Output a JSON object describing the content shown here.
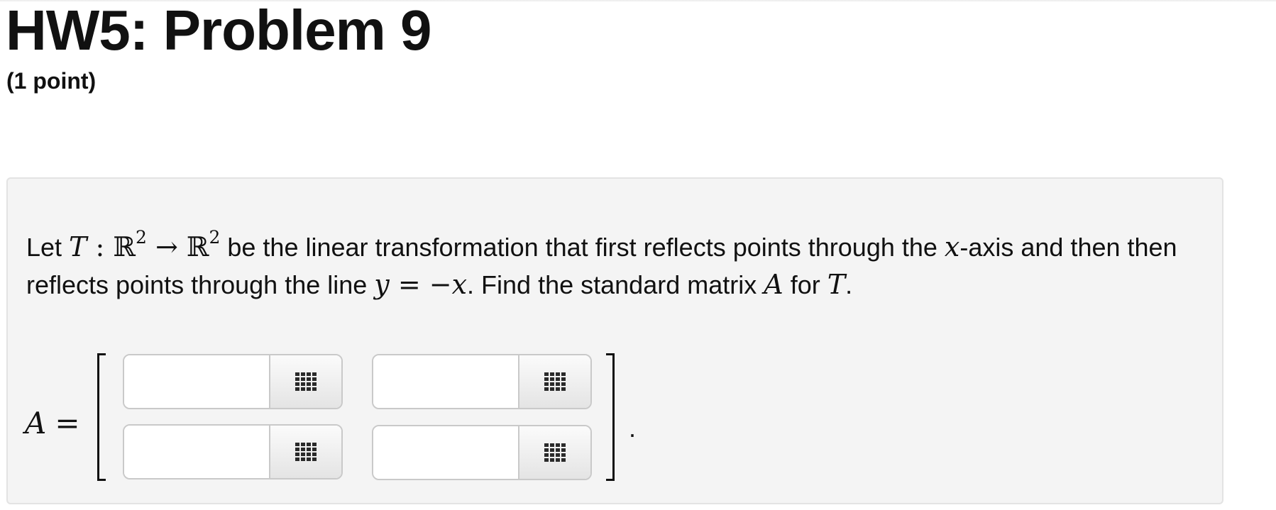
{
  "header": {
    "title": "HW5: Problem 9",
    "points": "(1 point)"
  },
  "problem": {
    "text_let": "Let ",
    "sym_T": "T",
    "sym_colon": " : ",
    "sym_R": "ℝ",
    "sym_exp": "2",
    "sym_arrow": " → ",
    "text_a": " be the linear transformation that first reflects points through the ",
    "sym_x": "x",
    "text_b": "-axis and then then reflects points through the line ",
    "sym_y": "y",
    "sym_eq_negx": " = −",
    "sym_x2": "x",
    "text_c": ". Find the standard matrix ",
    "sym_A": "A",
    "text_d": " for ",
    "sym_T2": "T",
    "text_e": "."
  },
  "answer": {
    "lhs_var": "A",
    "lhs_eq": "=",
    "end_dot": ".",
    "matrix_rows": 2,
    "matrix_cols": 2,
    "cells": [
      {
        "value": "",
        "button_icon": "matrix-grid-icon"
      },
      {
        "value": "",
        "button_icon": "matrix-grid-icon"
      },
      {
        "value": "",
        "button_icon": "matrix-grid-icon"
      },
      {
        "value": "",
        "button_icon": "matrix-grid-icon"
      }
    ]
  },
  "colors": {
    "panel_background": "#f4f4f4",
    "panel_border": "#e3e3e3",
    "input_border": "#c9c9c9"
  }
}
